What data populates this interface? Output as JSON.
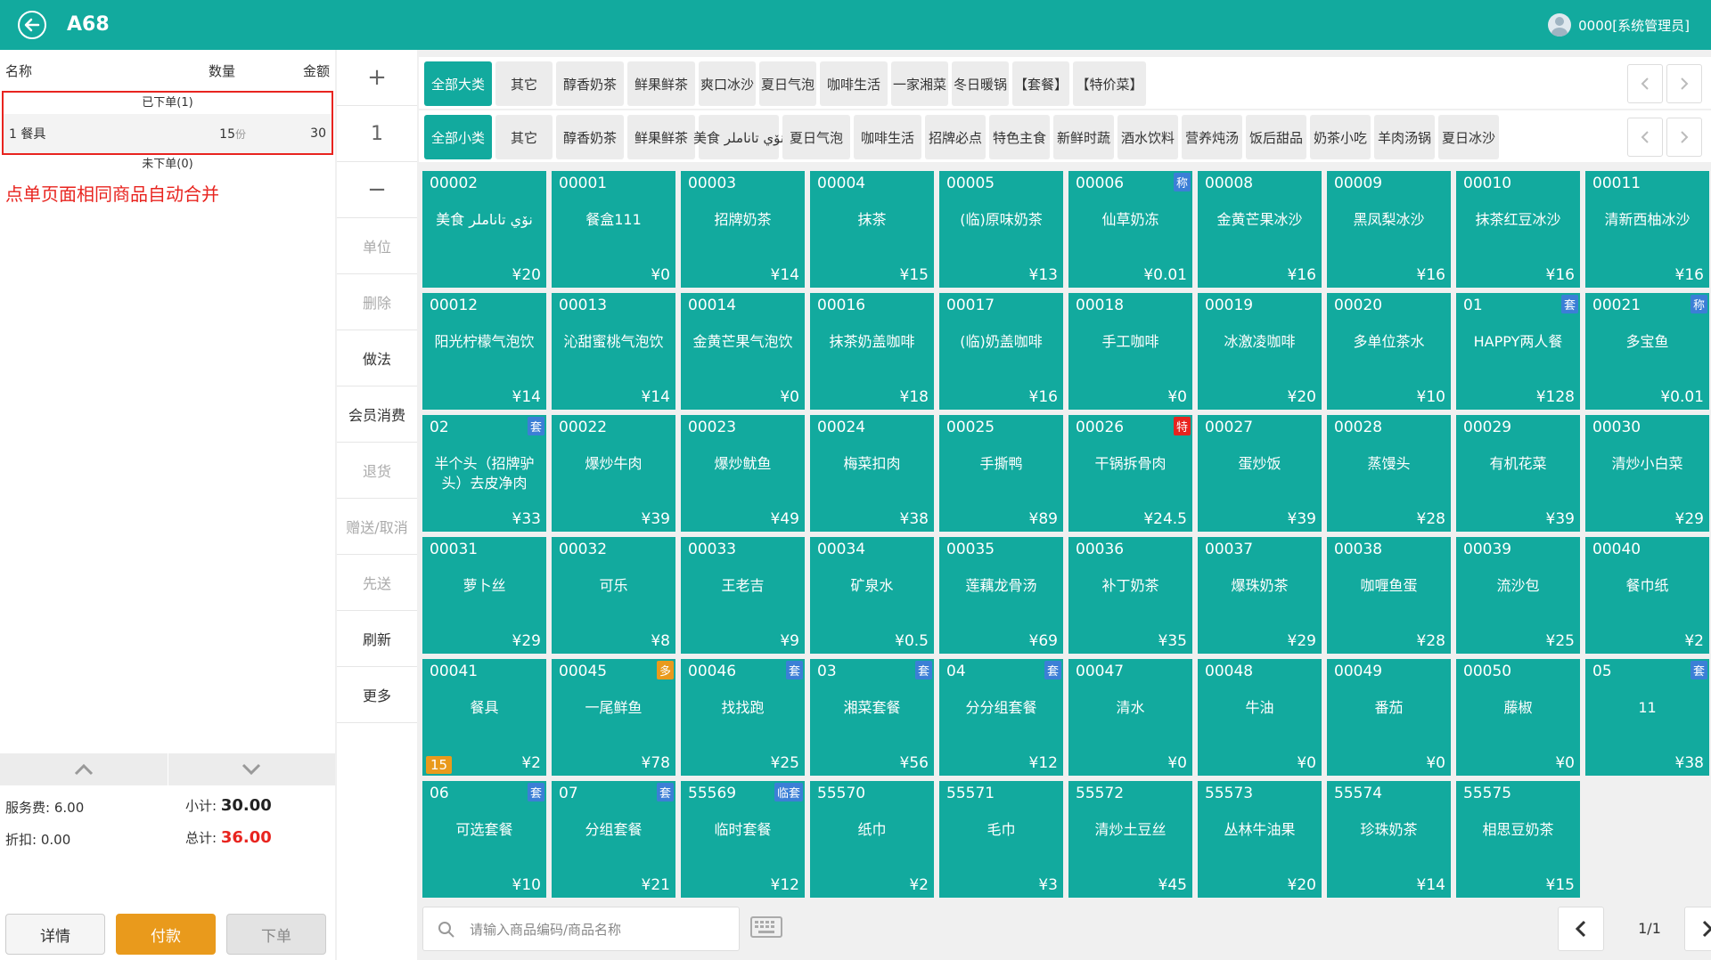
{
  "header": {
    "title": "A68",
    "user": "0000[系统管理员]"
  },
  "order": {
    "columns": {
      "name": "名称",
      "qty": "数量",
      "amount": "金额"
    },
    "ordered_label": "已下单(1)",
    "items": [
      {
        "index": "1",
        "name": "餐具",
        "qty": "15",
        "unit": "份",
        "amount": "30"
      }
    ],
    "not_ordered_label": "未下单(0)",
    "note": "点单页面相同商品自动合并"
  },
  "totals": {
    "service_label": "服务费:",
    "service_value": "6.00",
    "subtotal_label": "小计:",
    "subtotal_value": "30.00",
    "discount_label": "折扣:",
    "discount_value": "0.00",
    "total_label": "总计:",
    "total_value": "36.00"
  },
  "buttons": {
    "detail": "详情",
    "pay": "付款",
    "submit": "下单"
  },
  "actions": {
    "plus": "+",
    "qty": "1",
    "minus": "−",
    "items": [
      {
        "label": "单位",
        "dim": true
      },
      {
        "label": "删除",
        "dim": true
      },
      {
        "label": "做法",
        "dim": false
      },
      {
        "label": "会员消费",
        "dim": false
      },
      {
        "label": "退货",
        "dim": true
      },
      {
        "label": "赠送/取消",
        "dim": true
      },
      {
        "label": "先送",
        "dim": true
      },
      {
        "label": "刷新",
        "dim": false
      },
      {
        "label": "更多",
        "dim": false
      }
    ]
  },
  "categories_main": [
    "全部大类",
    "其它",
    "醇香奶茶",
    "鲜果鲜茶",
    "爽口冰沙",
    "夏日气泡",
    "咖啡生活",
    "一家湘菜",
    "冬日暖锅",
    "【套餐】",
    "【特价菜】"
  ],
  "categories_sub": [
    "全部小类",
    "其它",
    "醇香奶茶",
    "鲜果鲜茶",
    "美食 نۆي تاناملر",
    "夏日气泡",
    "咖啡生活",
    "招牌必点",
    "特色主食",
    "新鲜时蔬",
    "酒水饮料",
    "营养炖汤",
    "饭后甜品",
    "奶茶小吃",
    "羊肉汤锅",
    "夏日冰沙"
  ],
  "products": [
    {
      "code": "00002",
      "name": "美食 نۆي تاناملر",
      "price": "¥20",
      "badge": ""
    },
    {
      "code": "00001",
      "name": "餐盒111",
      "price": "¥0",
      "badge": ""
    },
    {
      "code": "00003",
      "name": "招牌奶茶",
      "price": "¥14",
      "badge": ""
    },
    {
      "code": "00004",
      "name": "抹茶",
      "price": "¥15",
      "badge": ""
    },
    {
      "code": "00005",
      "name": "(临)原味奶茶",
      "price": "¥13",
      "badge": ""
    },
    {
      "code": "00006",
      "name": "仙草奶冻",
      "price": "¥0.01",
      "badge": "称",
      "badge_color": "blue"
    },
    {
      "code": "00008",
      "name": "金黄芒果冰沙",
      "price": "¥16",
      "badge": ""
    },
    {
      "code": "00009",
      "name": "黑凤梨冰沙",
      "price": "¥16",
      "badge": ""
    },
    {
      "code": "00010",
      "name": "抹茶红豆冰沙",
      "price": "¥16",
      "badge": ""
    },
    {
      "code": "00011",
      "name": "清新西柚冰沙",
      "price": "¥16",
      "badge": ""
    },
    {
      "code": "00012",
      "name": "阳光柠檬气泡饮",
      "price": "¥14",
      "badge": ""
    },
    {
      "code": "00013",
      "name": "沁甜蜜桃气泡饮",
      "price": "¥14",
      "badge": ""
    },
    {
      "code": "00014",
      "name": "金黄芒果气泡饮",
      "price": "¥0",
      "badge": ""
    },
    {
      "code": "00016",
      "name": "抹茶奶盖咖啡",
      "price": "¥18",
      "badge": ""
    },
    {
      "code": "00017",
      "name": "(临)奶盖咖啡",
      "price": "¥16",
      "badge": ""
    },
    {
      "code": "00018",
      "name": "手工咖啡",
      "price": "¥0",
      "badge": ""
    },
    {
      "code": "00019",
      "name": "冰激凌咖啡",
      "price": "¥20",
      "badge": ""
    },
    {
      "code": "00020",
      "name": "多单位茶水",
      "price": "¥10",
      "badge": ""
    },
    {
      "code": "01",
      "name": "HAPPY两人餐",
      "price": "¥128",
      "badge": "套",
      "badge_color": "blue"
    },
    {
      "code": "00021",
      "name": "多宝鱼",
      "price": "¥0.01",
      "badge": "称",
      "badge_color": "blue"
    },
    {
      "code": "02",
      "name": "半个头（招牌驴头）去皮净肉",
      "price": "¥33",
      "badge": "套",
      "badge_color": "blue"
    },
    {
      "code": "00022",
      "name": "爆炒牛肉",
      "price": "¥39",
      "badge": ""
    },
    {
      "code": "00023",
      "name": "爆炒鱿鱼",
      "price": "¥49",
      "badge": ""
    },
    {
      "code": "00024",
      "name": "梅菜扣肉",
      "price": "¥38",
      "badge": ""
    },
    {
      "code": "00025",
      "name": "手撕鸭",
      "price": "¥89",
      "badge": ""
    },
    {
      "code": "00026",
      "name": "干锅拆骨肉",
      "price": "¥24.5",
      "badge": "特",
      "badge_color": "red"
    },
    {
      "code": "00027",
      "name": "蛋炒饭",
      "price": "¥39",
      "badge": ""
    },
    {
      "code": "00028",
      "name": "蒸馒头",
      "price": "¥28",
      "badge": ""
    },
    {
      "code": "00029",
      "name": "有机花菜",
      "price": "¥39",
      "badge": ""
    },
    {
      "code": "00030",
      "name": "清炒小白菜",
      "price": "¥29",
      "badge": ""
    },
    {
      "code": "00031",
      "name": "萝卜丝",
      "price": "¥29",
      "badge": ""
    },
    {
      "code": "00032",
      "name": "可乐",
      "price": "¥8",
      "badge": ""
    },
    {
      "code": "00033",
      "name": "王老吉",
      "price": "¥9",
      "badge": ""
    },
    {
      "code": "00034",
      "name": "矿泉水",
      "price": "¥0.5",
      "badge": ""
    },
    {
      "code": "00035",
      "name": "莲藕龙骨汤",
      "price": "¥69",
      "badge": ""
    },
    {
      "code": "00036",
      "name": "补丁奶茶",
      "price": "¥35",
      "badge": ""
    },
    {
      "code": "00037",
      "name": "爆珠奶茶",
      "price": "¥29",
      "badge": ""
    },
    {
      "code": "00038",
      "name": "咖喱鱼蛋",
      "price": "¥28",
      "badge": ""
    },
    {
      "code": "00039",
      "name": "流沙包",
      "price": "¥25",
      "badge": ""
    },
    {
      "code": "00040",
      "name": "餐巾纸",
      "price": "¥2",
      "badge": ""
    },
    {
      "code": "00041",
      "name": "餐具",
      "price": "¥2",
      "badge": "",
      "qty": "15"
    },
    {
      "code": "00045",
      "name": "一尾鲜鱼",
      "price": "¥78",
      "badge": "多",
      "badge_color": "orange"
    },
    {
      "code": "00046",
      "name": "找找跑",
      "price": "¥25",
      "badge": "套",
      "badge_color": "blue"
    },
    {
      "code": "03",
      "name": "湘菜套餐",
      "price": "¥56",
      "badge": "套",
      "badge_color": "blue"
    },
    {
      "code": "04",
      "name": "分分组套餐",
      "price": "¥12",
      "badge": "套",
      "badge_color": "blue"
    },
    {
      "code": "00047",
      "name": "清水",
      "price": "¥0",
      "badge": ""
    },
    {
      "code": "00048",
      "name": "牛油",
      "price": "¥0",
      "badge": ""
    },
    {
      "code": "00049",
      "name": "番茄",
      "price": "¥0",
      "badge": ""
    },
    {
      "code": "00050",
      "name": "藤椒",
      "price": "¥0",
      "badge": ""
    },
    {
      "code": "05",
      "name": "11",
      "price": "¥38",
      "badge": "套",
      "badge_color": "blue"
    },
    {
      "code": "06",
      "name": "可选套餐",
      "price": "¥10",
      "badge": "套",
      "badge_color": "blue"
    },
    {
      "code": "07",
      "name": "分组套餐",
      "price": "¥21",
      "badge": "套",
      "badge_color": "blue"
    },
    {
      "code": "55569",
      "name": "临时套餐",
      "price": "¥12",
      "badge": "临套",
      "badge_color": "blue"
    },
    {
      "code": "55570",
      "name": "纸巾",
      "price": "¥2",
      "badge": ""
    },
    {
      "code": "55571",
      "name": "毛巾",
      "price": "¥3",
      "badge": ""
    },
    {
      "code": "55572",
      "name": "清炒土豆丝",
      "price": "¥45",
      "badge": ""
    },
    {
      "code": "55573",
      "name": "丛林牛油果",
      "price": "¥20",
      "badge": ""
    },
    {
      "code": "55574",
      "name": "珍珠奶茶",
      "price": "¥14",
      "badge": ""
    },
    {
      "code": "55575",
      "name": "相思豆奶茶",
      "price": "¥15",
      "badge": ""
    }
  ],
  "search": {
    "placeholder": "请输入商品编码/商品名称"
  },
  "pager": {
    "text": "1/1"
  },
  "colors": {
    "accent": "#12aa9e",
    "pay": "#e99a1c",
    "alert": "#e8241f"
  }
}
